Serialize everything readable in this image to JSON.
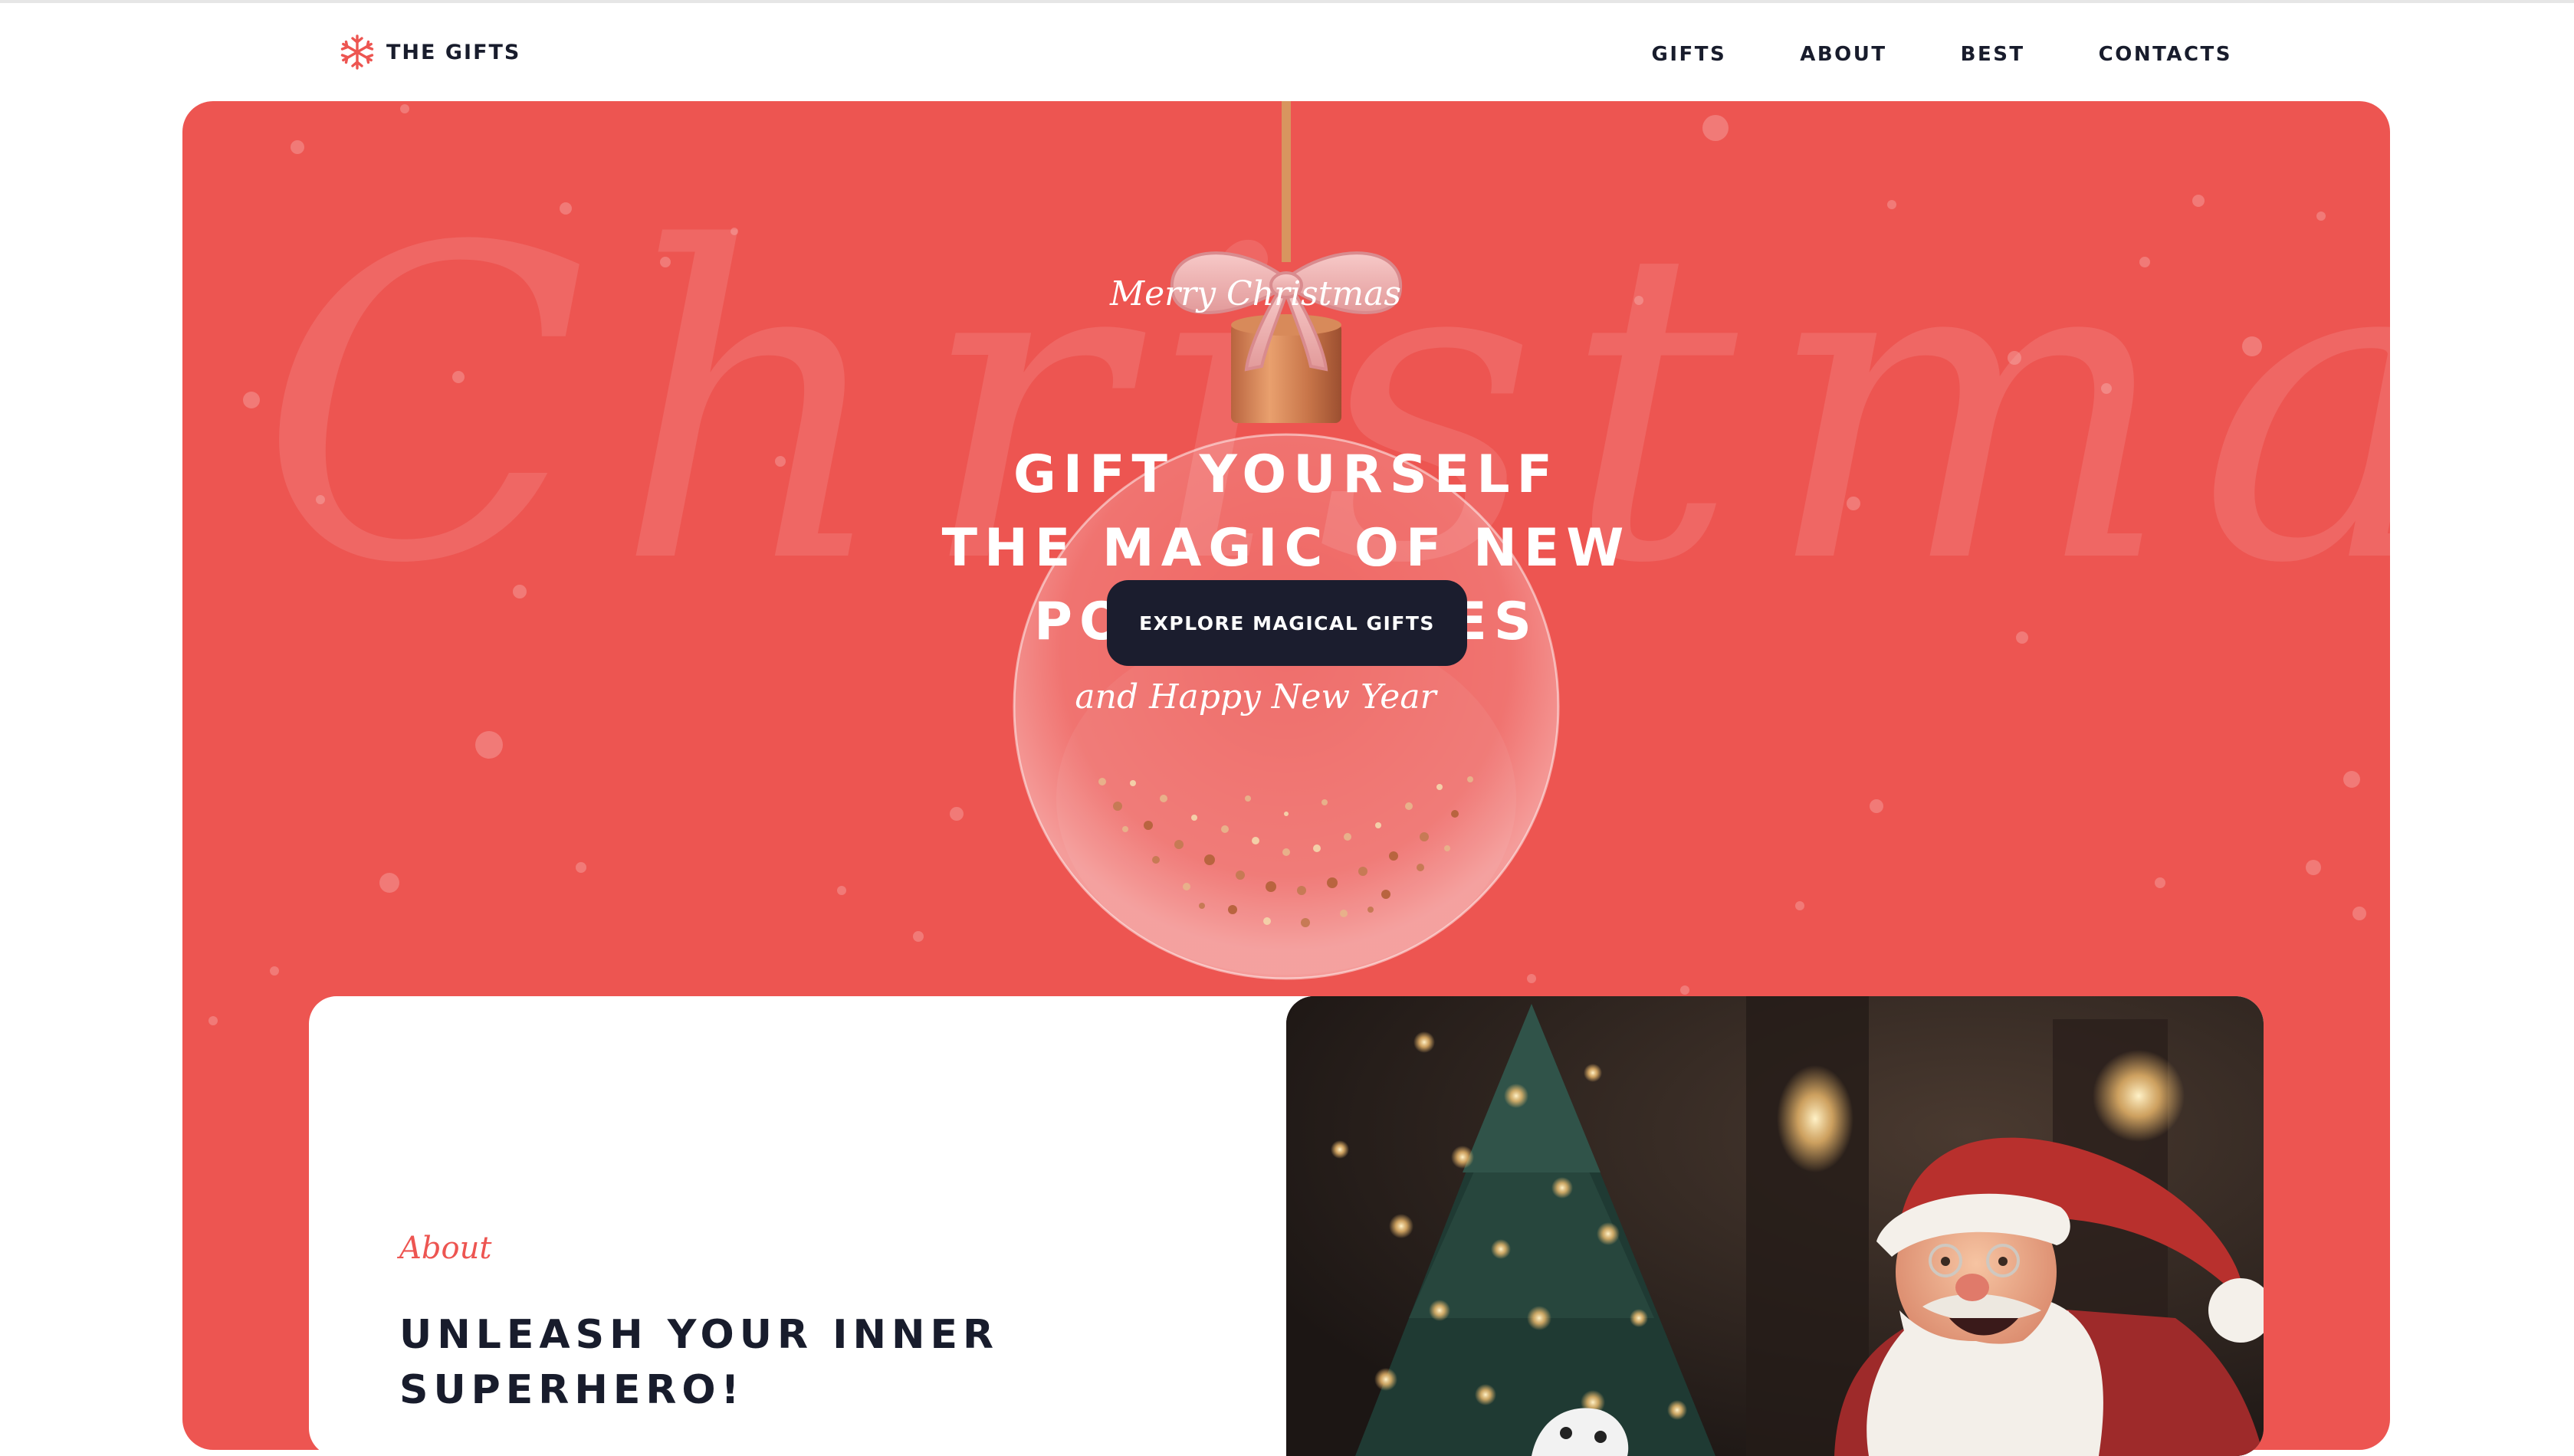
{
  "brand": {
    "name": "THE GIFTS",
    "icon": "snowflake-icon",
    "accent": "#ed5551"
  },
  "nav": {
    "items": [
      {
        "label": "GIFTS"
      },
      {
        "label": "ABOUT"
      },
      {
        "label": "BEST"
      },
      {
        "label": "CONTACTS"
      }
    ]
  },
  "hero": {
    "background_word": "Christmas",
    "greeting_top": "Merry Christmas",
    "headline": [
      "GIFT YOURSELF",
      "THE MAGIC OF NEW",
      "POSSIBILITIES"
    ],
    "cta_label": "EXPLORE MAGICAL GIFTS",
    "greeting_bottom": "and Happy New Year",
    "colors": {
      "background": "#ed5551",
      "button": "#1b1d2e"
    }
  },
  "about": {
    "eyebrow": "About",
    "title": [
      "UNLEASH YOUR INNER",
      "SUPERHERO!"
    ]
  }
}
